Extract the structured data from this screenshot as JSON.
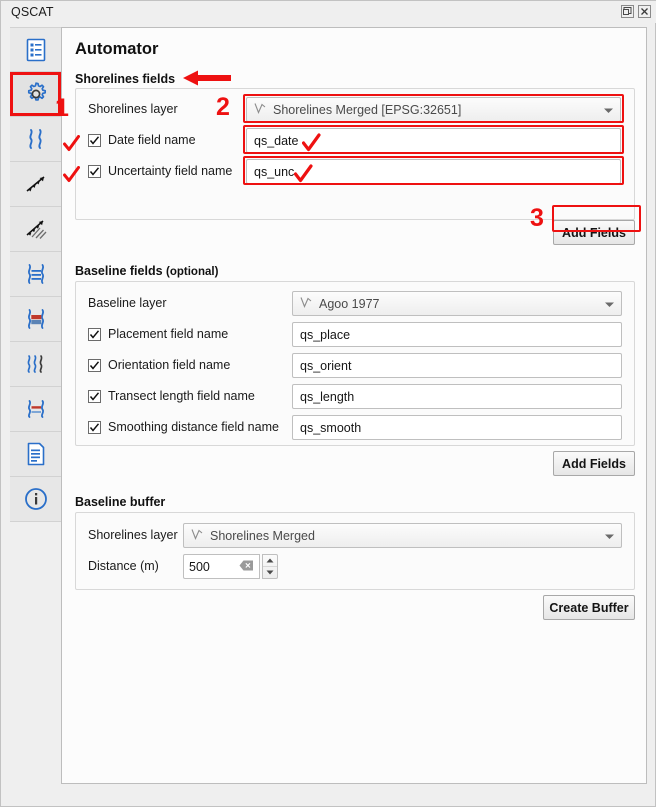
{
  "window": {
    "title": "QSCAT",
    "buttons": [
      {
        "name": "float-button",
        "glyph": "float"
      },
      {
        "name": "close-button",
        "glyph": "close"
      }
    ]
  },
  "sidebar": {
    "items": [
      {
        "icon": "document-list-icon",
        "label": "Summary Reports",
        "selected": false
      },
      {
        "icon": "gear-icon",
        "label": "Automator",
        "selected": true
      },
      {
        "icon": "shorelines-icon",
        "label": "Shorelines",
        "selected": false
      },
      {
        "icon": "baseline-icon",
        "label": "Baseline",
        "selected": false
      },
      {
        "icon": "transects-icon",
        "label": "Transects",
        "selected": false
      },
      {
        "icon": "shoreline-change-icon",
        "label": "Shoreline Change",
        "selected": false
      },
      {
        "icon": "area-change-icon",
        "label": "Area Change",
        "selected": false
      },
      {
        "icon": "forecasting-icon",
        "label": "Forecasting",
        "selected": false
      },
      {
        "icon": "visualization-icon",
        "label": "Visualization",
        "selected": false
      },
      {
        "icon": "summary-report-icon",
        "label": "Summary Report",
        "selected": false
      },
      {
        "icon": "info-icon",
        "label": "About",
        "selected": false
      }
    ]
  },
  "main": {
    "title": "Automator",
    "shorelines_fields": {
      "heading": "Shorelines fields",
      "layer_row": {
        "label": "Shorelines layer",
        "value": "Shorelines Merged [EPSG:32651]",
        "icon": "line-layer-icon"
      },
      "fields": [
        {
          "label": "Date field name",
          "checked": true,
          "value": "qs_date",
          "annotated": true
        },
        {
          "label": "Uncertainty field name",
          "checked": true,
          "value": "qs_unc",
          "annotated": true
        }
      ],
      "add_fields_label": "Add Fields"
    },
    "baseline_fields": {
      "heading": "Baseline fields",
      "heading_optional": "(optional)",
      "layer_row": {
        "label": "Baseline layer",
        "value": "Agoo 1977",
        "icon": "line-layer-icon"
      },
      "fields": [
        {
          "label": "Placement field name",
          "checked": true,
          "value": "qs_place"
        },
        {
          "label": "Orientation field name",
          "checked": true,
          "value": "qs_orient"
        },
        {
          "label": "Transect length field name",
          "checked": true,
          "value": "qs_length"
        },
        {
          "label": "Smoothing distance field name",
          "checked": true,
          "value": "qs_smooth"
        }
      ],
      "add_fields_label": "Add Fields"
    },
    "baseline_buffer": {
      "heading": "Baseline buffer",
      "layer_row": {
        "label": "Shorelines layer",
        "value": "Shorelines Merged",
        "icon": "line-layer-icon"
      },
      "distance_row": {
        "label": "Distance (m)",
        "value": "500"
      },
      "create_buffer_label": "Create Buffer"
    }
  },
  "annotations": {
    "numbers": [
      {
        "text": "1",
        "target": "gear-sidebar-item"
      },
      {
        "text": "2",
        "target": "shorelines-layer-combo"
      },
      {
        "text": "3",
        "target": "shorelines-add-fields-button"
      }
    ],
    "arrow": {
      "direction": "left",
      "target": "shorelines-fields-heading"
    },
    "checkmarks": 4,
    "color": "#ee1111"
  }
}
